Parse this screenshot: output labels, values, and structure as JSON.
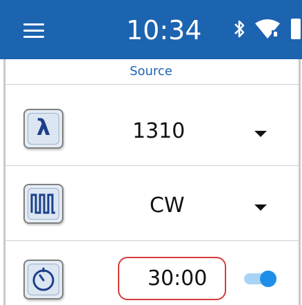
{
  "status_bar": {
    "time": "10:34",
    "icons": [
      "menu-icon",
      "bluetooth-icon",
      "wifi-icon",
      "battery-icon"
    ],
    "background": "#1c63b0"
  },
  "page": {
    "title": "Source"
  },
  "rows": [
    {
      "icon": "wavelength-lambda-icon",
      "icon_text": "λ",
      "value": "1310",
      "control": "dropdown"
    },
    {
      "icon": "modulation-wave-icon",
      "value": "CW",
      "control": "dropdown"
    },
    {
      "icon": "timer-icon",
      "value": "30:00",
      "control": "toggle",
      "toggle_on": true
    }
  ],
  "colors": {
    "accent": "#1c63b0",
    "highlight": "#d63a3a",
    "toggle": "#1e8fe8"
  }
}
